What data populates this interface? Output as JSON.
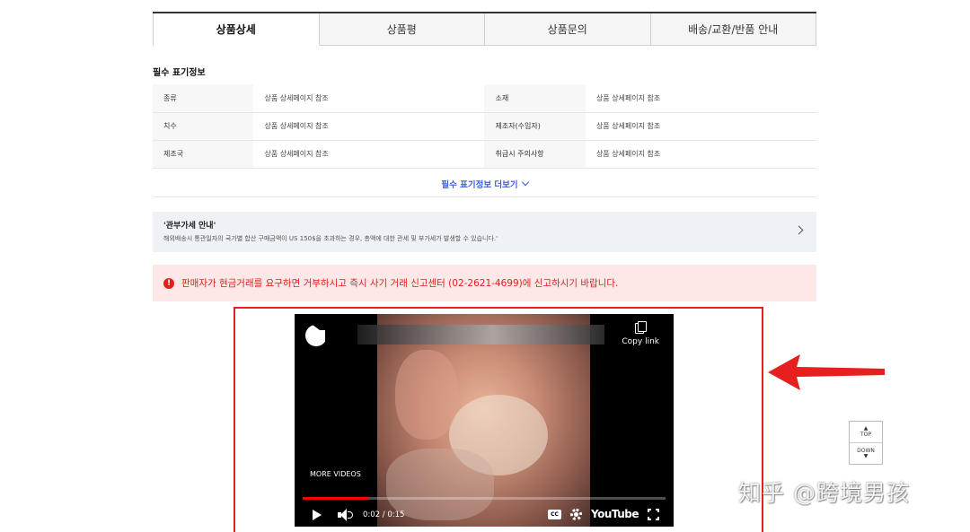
{
  "tabs": [
    {
      "label": "상품상세",
      "active": true
    },
    {
      "label": "상품평",
      "active": false
    },
    {
      "label": "상품문의",
      "active": false
    },
    {
      "label": "배송/교환/반품 안내",
      "active": false
    }
  ],
  "required_info": {
    "title": "필수 표기정보",
    "rows": [
      {
        "label1": "종류",
        "value1": "상품 상세페이지 참조",
        "label2": "소재",
        "value2": "상품 상세페이지 참조"
      },
      {
        "label1": "치수",
        "value1": "상품 상세페이지 참조",
        "label2": "제조자(수입자)",
        "value2": "상품 상세페이지 참조"
      },
      {
        "label1": "제조국",
        "value1": "상품 상세페이지 참조",
        "label2": "취급시 주의사항",
        "value2": "상품 상세페이지 참조"
      }
    ],
    "more_label": "필수 표기정보 더보기"
  },
  "customs_notice": {
    "title": "'관부가세 안내'",
    "text": "해외배송시 통관일자의 국가별 합산 구매금액이 US 150$을 초과하는 경우, 총액에 대한 관세 및 부가세가 발생할 수 있습니다.'"
  },
  "warning": {
    "icon": "!",
    "text": "판매자가 현금거래를 요구하면 거부하시고 즉시 사기 거래 신고센터 (02-2621-4699)에 신고하시기 바랍니다."
  },
  "video": {
    "copy_link": "Copy link",
    "more_videos": "MORE VIDEOS",
    "time": "0:02 / 0:15",
    "progress": 0.18,
    "cc": "CC",
    "brand": "YouTube"
  },
  "scroll": {
    "top": "TOP",
    "down": "DOWN"
  },
  "watermark": "知乎 @跨境男孩",
  "colors": {
    "accent_blue": "#3b5ee6",
    "warning_red": "#e0201d",
    "highlight_red": "#e5201f",
    "progress_red": "#ff0000"
  }
}
